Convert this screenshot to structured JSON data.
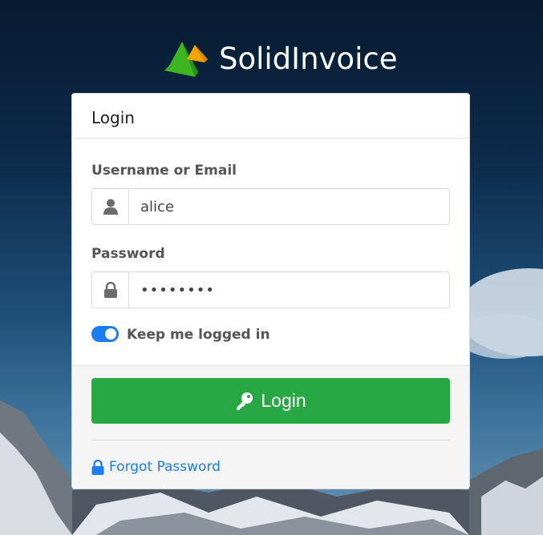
{
  "app": {
    "name": "SolidInvoice"
  },
  "card": {
    "title": "Login",
    "username": {
      "label": "Username or Email",
      "value": "alice"
    },
    "password": {
      "label": "Password",
      "value": "••••••••"
    },
    "remember": {
      "label": "Keep me logged in",
      "checked": true
    },
    "login_button": {
      "label": "Login"
    },
    "forgot_link": {
      "label": "Forgot Password"
    }
  },
  "colors": {
    "primary": "#28a745",
    "link": "#1c7cf2",
    "logo_green": "#3cb521",
    "logo_orange": "#f6a500"
  }
}
